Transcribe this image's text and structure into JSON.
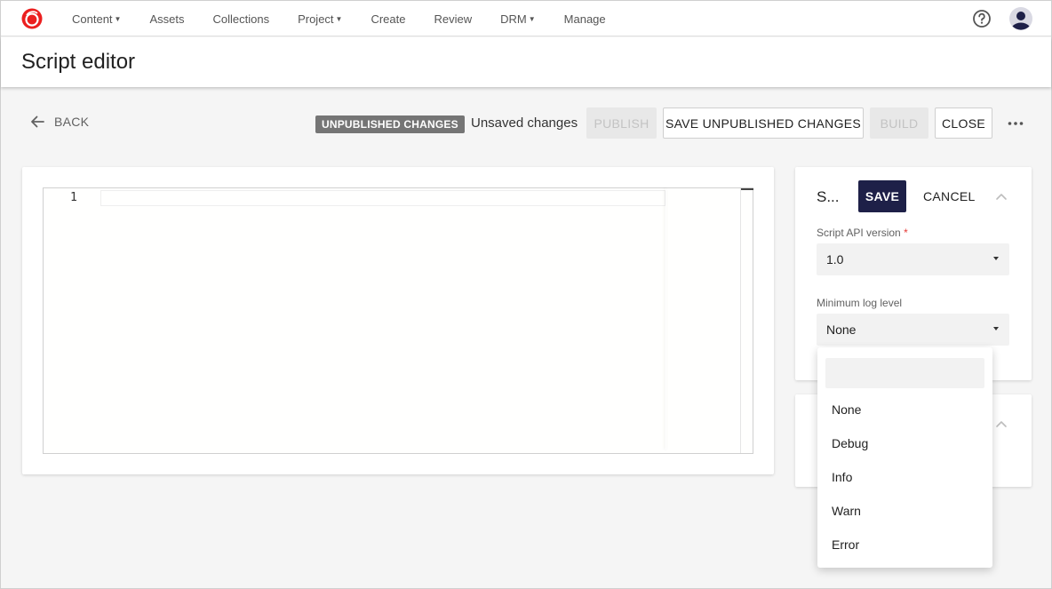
{
  "nav": {
    "items": [
      {
        "label": "Content",
        "has_caret": true
      },
      {
        "label": "Assets",
        "has_caret": false
      },
      {
        "label": "Collections",
        "has_caret": false
      },
      {
        "label": "Project",
        "has_caret": true
      },
      {
        "label": "Create",
        "has_caret": false
      },
      {
        "label": "Review",
        "has_caret": false
      },
      {
        "label": "DRM",
        "has_caret": true
      },
      {
        "label": "Manage",
        "has_caret": false
      }
    ],
    "logo_icon": "sitecore-logo-icon",
    "help_icon": "help-circle-icon",
    "avatar_icon": "user-avatar-icon"
  },
  "header": {
    "title": "Script editor"
  },
  "toolbar": {
    "back_label": "BACK",
    "status_badge": "UNPUBLISHED CHANGES",
    "unsaved_text": "Unsaved changes",
    "publish_label": "PUBLISH",
    "save_unpublished_label": "SAVE UNPUBLISHED CHANGES",
    "build_label": "BUILD",
    "close_label": "CLOSE"
  },
  "editor": {
    "line_numbers": [
      "1"
    ]
  },
  "settings_panel": {
    "title": "S...",
    "save_label": "SAVE",
    "cancel_label": "CANCEL",
    "api_version_label": "Script API version",
    "api_version_required_mark": "*",
    "api_version_value": "1.0",
    "log_level_label": "Minimum log level",
    "log_level_value": "None"
  },
  "dropdown": {
    "search_placeholder": "",
    "options": [
      "None",
      "Debug",
      "Info",
      "Warn",
      "Error"
    ]
  },
  "colors": {
    "save_button_bg": "#1e2048",
    "badge_bg": "#757575",
    "logo_red": "#eb1f1f"
  }
}
